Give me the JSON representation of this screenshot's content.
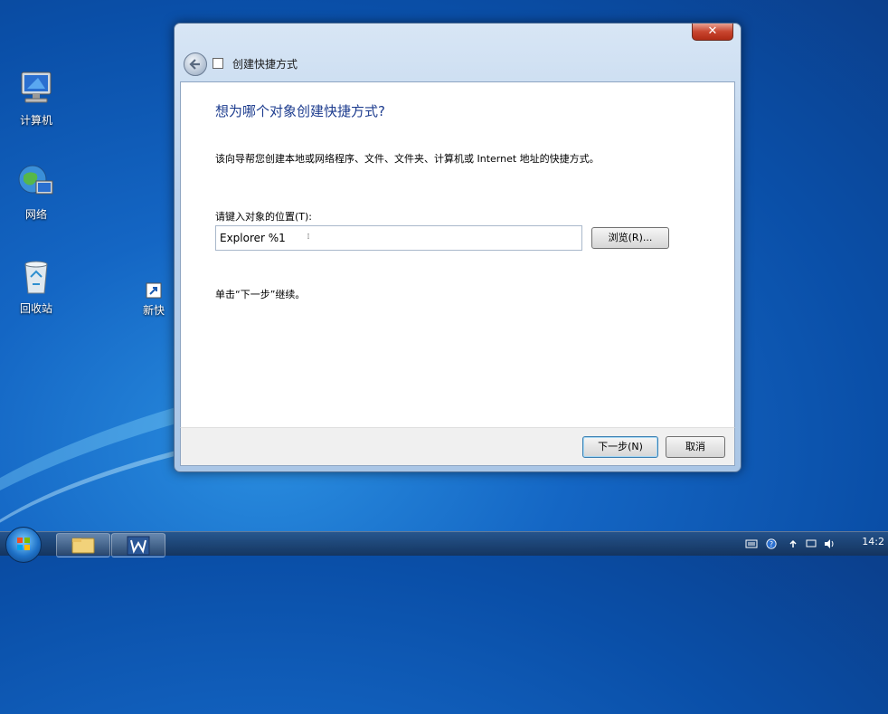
{
  "desktop": {
    "icons": [
      {
        "label": "计算机"
      },
      {
        "label": "网络"
      },
      {
        "label": "回收站"
      },
      {
        "label": "新快"
      }
    ]
  },
  "window": {
    "close_label": "✕",
    "title": "创建快捷方式",
    "heading": "想为哪个对象创建快捷方式?",
    "description": "该向导帮您创建本地或网络程序、文件、文件夹、计算机或 Internet 地址的快捷方式。",
    "location_label": "请键入对象的位置(T):",
    "location_value": "Explorer %1",
    "browse_label": "浏览(R)...",
    "hint": "单击“下一步”继续。",
    "next_label": "下一步(N)",
    "cancel_label": "取消"
  },
  "taskbar": {
    "clock": "14:2"
  },
  "colors": {
    "heading": "#1e3d8f",
    "close": "#c8452f"
  }
}
